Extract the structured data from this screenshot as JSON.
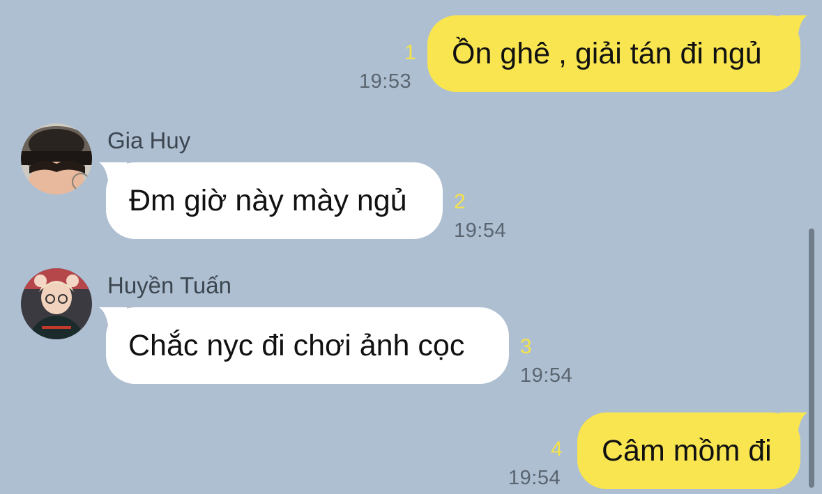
{
  "messages": [
    {
      "direction": "outgoing",
      "text": "Ồn ghê , giải tán đi ngủ",
      "read_count": "1",
      "time": "19:53"
    },
    {
      "direction": "incoming",
      "sender": "Gia Huy",
      "text": "Đm giờ này mày ngủ",
      "read_count": "2",
      "time": "19:54"
    },
    {
      "direction": "incoming",
      "sender": "Huyền Tuấn",
      "text": "Chắc nyc đi chơi ảnh cọc",
      "read_count": "3",
      "time": "19:54"
    },
    {
      "direction": "outgoing",
      "text": "Câm mồm đi",
      "read_count": "4",
      "time": "19:54"
    }
  ],
  "colors": {
    "background": "#aebfd1",
    "outgoing_bubble": "#f9e550",
    "incoming_bubble": "#ffffff",
    "read_count": "#f4e24a",
    "timestamp": "#5a6570"
  }
}
